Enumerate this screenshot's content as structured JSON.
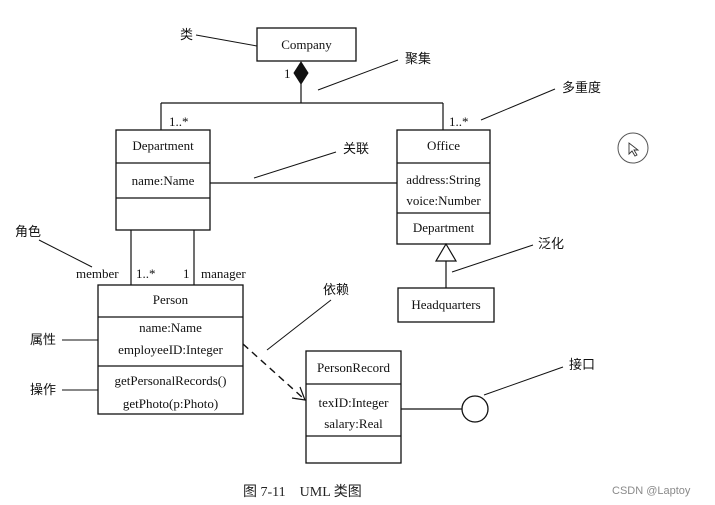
{
  "classes": {
    "company": {
      "name": "Company"
    },
    "department": {
      "name": "Department",
      "attributes": [
        "name:Name"
      ]
    },
    "office": {
      "name": "Office",
      "attributes": [
        "address:String",
        "voice:Number"
      ],
      "operations": [
        "Department"
      ]
    },
    "headquarters": {
      "name": "Headquarters"
    },
    "person": {
      "name": "Person",
      "attributes": [
        "name:Name",
        "employeeID:Integer"
      ],
      "operations": [
        "getPersonalRecords()",
        "getPhoto(p:Photo)"
      ]
    },
    "personrecord": {
      "name": "PersonRecord",
      "attributes": [
        "texID:Integer",
        "salary:Real"
      ]
    }
  },
  "multiplicities": {
    "company_end": "1",
    "department_end": "1..*",
    "office_end": "1..*",
    "member": "1..*",
    "manager": "1"
  },
  "roles": {
    "member": "member",
    "manager": "manager"
  },
  "annotations": {
    "class": "类",
    "aggregation": "聚集",
    "multiplicity": "多重度",
    "association": "关联",
    "role": "角色",
    "generalization": "泛化",
    "dependency": "依赖",
    "attribute": "属性",
    "operation": "操作",
    "interface": "接口"
  },
  "caption": "图 7-11    UML 类图",
  "watermark": "CSDN @Laptoy",
  "cursor_icon": "cursor-circle-icon"
}
